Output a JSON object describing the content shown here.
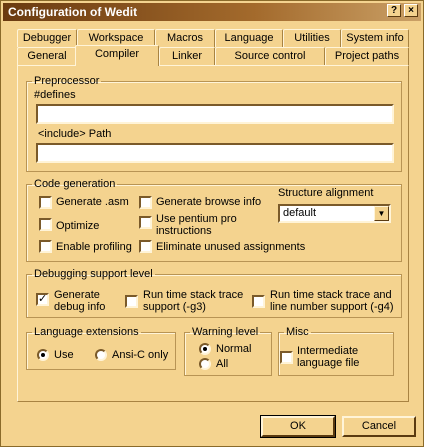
{
  "window": {
    "title": "Configuration of Wedit"
  },
  "title_buttons": {
    "help": "?",
    "close": "×"
  },
  "tabs_row1": [
    "Debugger",
    "Workspace",
    "Macros",
    "Language",
    "Utilities",
    "System info"
  ],
  "tabs_row2": [
    "General",
    "Compiler",
    "Linker",
    "Source control",
    "Project paths"
  ],
  "active_tab": "Compiler",
  "preprocessor": {
    "legend": "Preprocessor",
    "defines_label": "#defines",
    "defines_value": "",
    "include_label": "<include> Path",
    "include_value": ""
  },
  "code_generation": {
    "legend": "Code generation",
    "generate_asm": {
      "label": "Generate .asm",
      "checked": false
    },
    "optimize": {
      "label": "Optimize",
      "checked": false
    },
    "enable_profiling": {
      "label": "Enable profiling",
      "checked": false
    },
    "generate_browse": {
      "label": "Generate browse info",
      "checked": false
    },
    "use_pentium": {
      "label_line1": "Use pentium pro",
      "label_line2": "instructions",
      "checked": false
    },
    "eliminate_unused": {
      "label": "Eliminate unused assignments",
      "checked": false
    },
    "structure_alignment_label": "Structure alignment",
    "structure_alignment_value": "default"
  },
  "debugging": {
    "legend": "Debugging support level",
    "generate_debug": {
      "label_line1": "Generate",
      "label_line2": "debug info",
      "checked": true
    },
    "run_time_g3": {
      "label_line1": "Run time stack trace",
      "label_line2": "support (-g3)",
      "checked": false
    },
    "run_time_g4": {
      "label_line1": "Run time stack trace and",
      "label_line2": "line number support (-g4)",
      "checked": false
    }
  },
  "language_extensions": {
    "legend": "Language extensions",
    "use": {
      "label": "Use",
      "selected": true
    },
    "ansi_c": {
      "label": "Ansi-C only",
      "selected": false
    }
  },
  "warning_level": {
    "legend": "Warning level",
    "normal": {
      "label": "Normal",
      "selected": true
    },
    "all": {
      "label": "All",
      "selected": false
    }
  },
  "misc": {
    "legend": "Misc",
    "intermediate": {
      "label_line1": "Intermediate",
      "label_line2": "language file",
      "checked": false
    }
  },
  "buttons": {
    "ok": "OK",
    "cancel": "Cancel"
  }
}
